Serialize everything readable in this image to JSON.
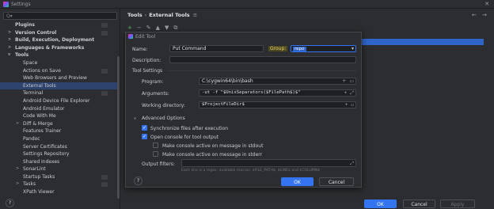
{
  "window": {
    "title": "Settings",
    "close": "✕"
  },
  "search": {
    "placeholder": "Q▾"
  },
  "sidebar": {
    "items": [
      {
        "label": "Plugins",
        "level": 0,
        "bold": true,
        "arrow": "",
        "badge": true
      },
      {
        "label": "Version Control",
        "level": 0,
        "bold": true,
        "arrow": ">",
        "badge": true
      },
      {
        "label": "Build, Execution, Deployment",
        "level": 0,
        "bold": true,
        "arrow": ">",
        "badge": false
      },
      {
        "label": "Languages & Frameworks",
        "level": 0,
        "bold": true,
        "arrow": ">",
        "badge": false
      },
      {
        "label": "Tools",
        "level": 0,
        "bold": true,
        "arrow": "v",
        "badge": false
      },
      {
        "label": "Space",
        "level": 1,
        "arrow": ""
      },
      {
        "label": "Actions on Save",
        "level": 1,
        "arrow": "",
        "badge": true
      },
      {
        "label": "Web Browsers and Preview",
        "level": 1,
        "arrow": ""
      },
      {
        "label": "External Tools",
        "level": 1,
        "arrow": "",
        "selected": true
      },
      {
        "label": "Terminal",
        "level": 1,
        "arrow": "",
        "badge": true
      },
      {
        "label": "Android Device File Explorer",
        "level": 1,
        "arrow": ""
      },
      {
        "label": "Android Emulator",
        "level": 1,
        "arrow": ""
      },
      {
        "label": "Code With Me",
        "level": 1,
        "arrow": ""
      },
      {
        "label": "Diff & Merge",
        "level": 1,
        "arrow": ">"
      },
      {
        "label": "Features Trainer",
        "level": 1,
        "arrow": ""
      },
      {
        "label": "Pandoc",
        "level": 1,
        "arrow": ""
      },
      {
        "label": "Server Certificates",
        "level": 1,
        "arrow": ""
      },
      {
        "label": "Settings Repository",
        "level": 1,
        "arrow": ""
      },
      {
        "label": "Shared Indexes",
        "level": 1,
        "arrow": ""
      },
      {
        "label": "SonarLint",
        "level": 1,
        "arrow": ">"
      },
      {
        "label": "Startup Tasks",
        "level": 1,
        "arrow": "",
        "badge": true
      },
      {
        "label": "Tasks",
        "level": 1,
        "arrow": ">",
        "badge": true
      },
      {
        "label": "XPath Viewer",
        "level": 1,
        "arrow": ""
      }
    ]
  },
  "breadcrumb": {
    "parent": "Tools",
    "sep": "›",
    "current": "External Tools",
    "menu": "≡"
  },
  "nav": {
    "back": "←",
    "forward": "→"
  },
  "toolbar": {
    "add": "+",
    "remove": "−",
    "edit": "✎",
    "up": "▲",
    "down": "▼",
    "copy": "⧉"
  },
  "dialog": {
    "title": "Edit Tool",
    "name_label": "Name:",
    "name_value": "Put Command",
    "group_label": "Group:",
    "group_value": "repo",
    "group_chevron": "▾",
    "description_label": "Description:",
    "description_value": "",
    "tool_settings": "Tool Settings",
    "program_label": "Program:",
    "program_value": "C:\\cygwin64\\bin\\bash",
    "arguments_label": "Arguments:",
    "arguments_value": "-ut -f \"$UnixSeparators($FilePath$)$\"",
    "workdir_label": "Working directory:",
    "workdir_value": "$ProjectFileDir$",
    "field_plus": "+",
    "field_folder": "▭",
    "field_expand": "⤢",
    "advanced_label": "Advanced Options",
    "advanced_arrow": "v",
    "opt_sync": "Synchronize files after execution",
    "opt_console": "Open console for tool output",
    "opt_stdout": "Make console active on message in stdout",
    "opt_stderr": "Make console active on message in stderr",
    "filters_label": "Output filters:",
    "filters_hint": "Each line is a regex, available macros: $FILE_PATH$, $LINE$ and $COLUMN$",
    "help": "?",
    "ok": "OK",
    "cancel": "Cancel",
    "check": "✓"
  },
  "footer": {
    "help": "?",
    "ok": "OK",
    "cancel": "Cancel",
    "apply": "Apply"
  },
  "colors": {
    "accent": "#3574f0",
    "selection": "#2e436e",
    "background": "#2b2d30"
  }
}
